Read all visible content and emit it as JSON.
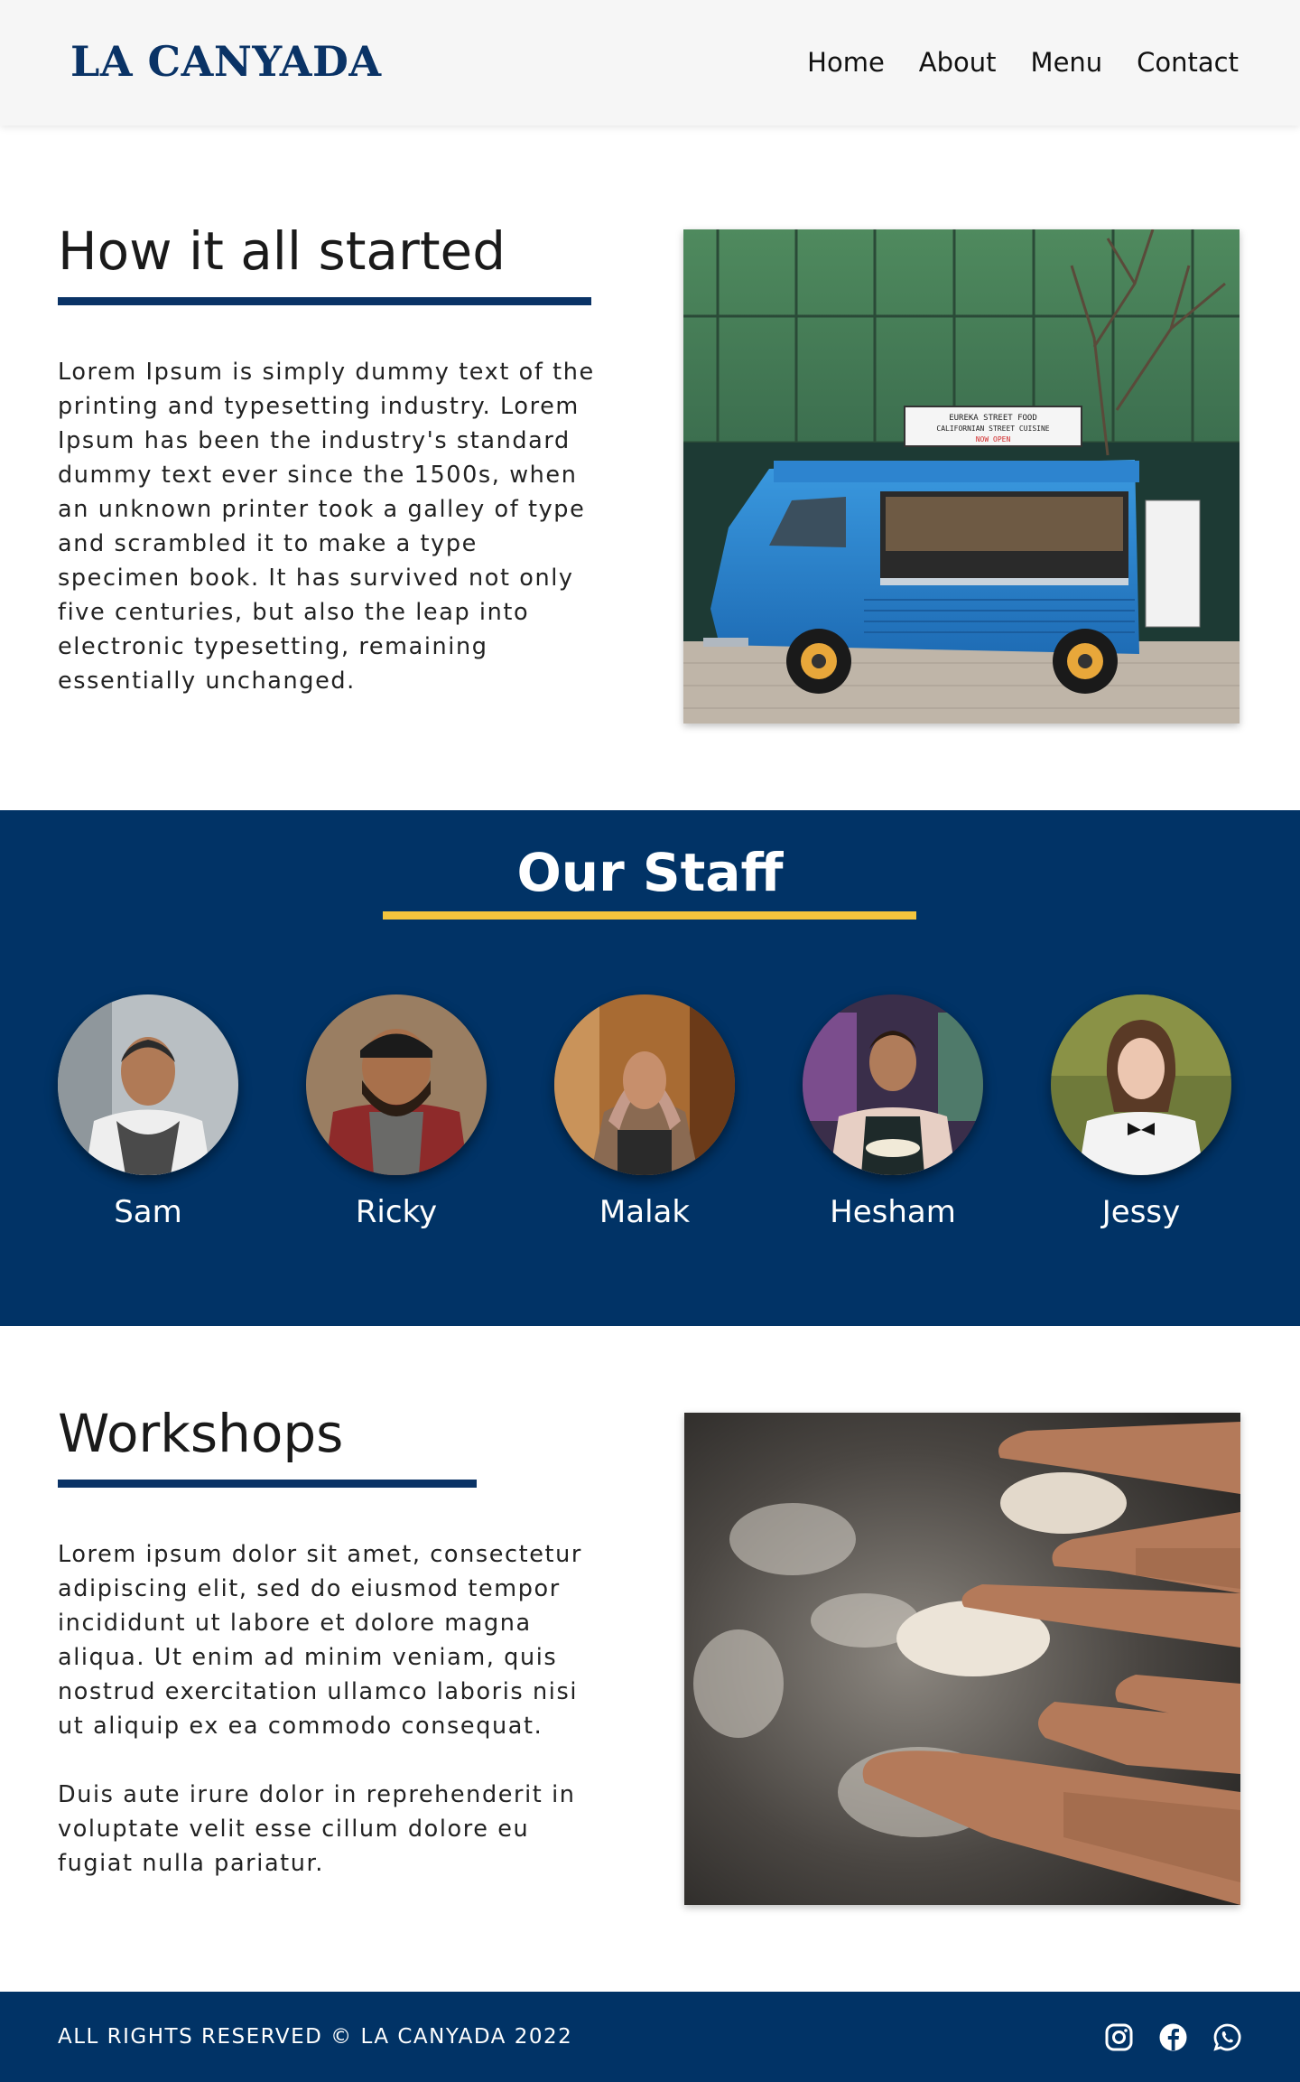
{
  "header": {
    "logo": "LA CANYADA",
    "nav": [
      "Home",
      "About",
      "Menu",
      "Contact"
    ]
  },
  "story": {
    "title": "How it all started",
    "text": "Lorem Ipsum is simply dummy text of the printing and typesetting industry. Lorem Ipsum has been the industry's standard dummy text ever since the 1500s, when an unknown printer took a galley of type and scrambled it to make a type specimen book. It has survived not only five centuries, but also the leap into electronic typesetting, remaining essentially unchanged.",
    "truck_sign": [
      "EUREKA STREET FOOD",
      "CALIFORNIAN STREET CUISINE",
      "NOW OPEN"
    ]
  },
  "staff": {
    "title": "Our Staff",
    "members": [
      {
        "name": "Sam"
      },
      {
        "name": "Ricky"
      },
      {
        "name": "Malak"
      },
      {
        "name": "Hesham"
      },
      {
        "name": "Jessy"
      }
    ]
  },
  "workshops": {
    "title": "Workshops",
    "paragraphs": [
      "Lorem ipsum dolor sit amet, consectetur adipiscing elit, sed do eiusmod tempor incididunt ut labore et dolore magna aliqua. Ut enim ad minim veniam, quis nostrud exercitation ullamco laboris nisi ut aliquip ex ea commodo consequat.",
      "Duis aute irure dolor in reprehenderit in voluptate velit esse cillum dolore eu fugiat nulla pariatur."
    ]
  },
  "footer": {
    "copyright": "ALL RIGHTS RESERVED © LA CANYADA 2022",
    "social_icons": [
      "instagram-icon",
      "facebook-icon",
      "whatsapp-icon"
    ]
  },
  "colors": {
    "brand_navy": "#013366",
    "accent_yellow": "#f4c43d",
    "header_bg": "#f6f6f6"
  }
}
